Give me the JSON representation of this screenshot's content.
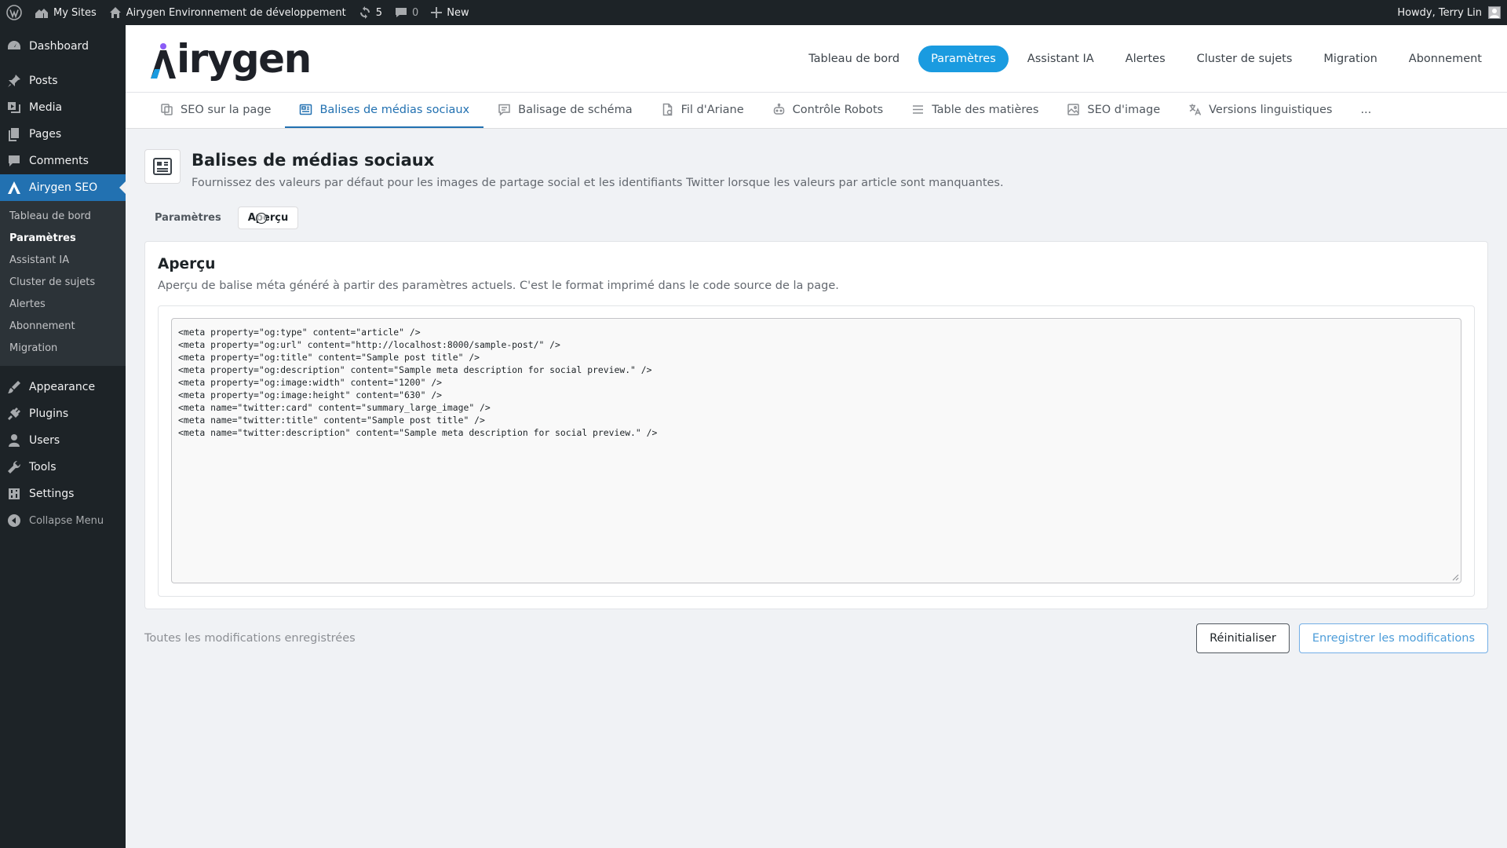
{
  "admin_bar": {
    "wp_logo_icon": "wordpress-icon",
    "my_sites": "My Sites",
    "site_name": "Airygen Environnement de développement",
    "updates_count": "5",
    "comments_count": "0",
    "new_label": "New",
    "howdy": "Howdy, Terry Lin"
  },
  "sidebar": {
    "items_top": [
      {
        "label": "Dashboard",
        "icon": "dashboard-icon"
      },
      {
        "label": "Posts",
        "icon": "pin-icon"
      },
      {
        "label": "Media",
        "icon": "media-icon"
      },
      {
        "label": "Pages",
        "icon": "pages-icon"
      },
      {
        "label": "Comments",
        "icon": "comment-icon"
      }
    ],
    "current": {
      "label": "Airygen SEO",
      "icon": "airygen-icon"
    },
    "submenu": [
      "Tableau de bord",
      "Paramètres",
      "Assistant IA",
      "Cluster de sujets",
      "Alertes",
      "Abonnement",
      "Migration"
    ],
    "submenu_active": "Paramètres",
    "items_bottom": [
      {
        "label": "Appearance",
        "icon": "brush-icon"
      },
      {
        "label": "Plugins",
        "icon": "plug-icon"
      },
      {
        "label": "Users",
        "icon": "user-icon"
      },
      {
        "label": "Tools",
        "icon": "wrench-icon"
      },
      {
        "label": "Settings",
        "icon": "settings-icon"
      }
    ],
    "collapse": "Collapse Menu"
  },
  "header": {
    "logo_text": "irygen",
    "brand_colors": {
      "dark": "#1e2128",
      "purple": "#8a5cf6",
      "blue": "#1a9be0"
    },
    "nav": [
      "Tableau de bord",
      "Paramètres",
      "Assistant IA",
      "Alertes",
      "Cluster de sujets",
      "Migration",
      "Abonnement"
    ],
    "nav_active": "Paramètres"
  },
  "subtabs": [
    {
      "label": "SEO sur la page",
      "icon": "copy-icon"
    },
    {
      "label": "Balises de médias sociaux",
      "icon": "newspaper-icon"
    },
    {
      "label": "Balisage de schéma",
      "icon": "message-icon"
    },
    {
      "label": "Fil d'Ariane",
      "icon": "file-icon"
    },
    {
      "label": "Contrôle Robots",
      "icon": "robot-icon"
    },
    {
      "label": "Table des matières",
      "icon": "list-icon"
    },
    {
      "label": "SEO d'image",
      "icon": "image-icon"
    },
    {
      "label": "Versions linguistiques",
      "icon": "translate-icon"
    }
  ],
  "subtabs_more": "...",
  "page": {
    "title": "Balises de médias sociaux",
    "description": "Fournissez des valeurs par défaut pour les images de partage social et les identifiants Twitter lorsque les valeurs par article sont manquantes.",
    "inner_tabs": [
      "Paramètres",
      "Aperçu"
    ],
    "inner_tab_active": "Aperçu"
  },
  "preview": {
    "title": "Aperçu",
    "description": "Aperçu de balise méta généré à partir des paramètres actuels. C'est le format imprimé dans le code source de la page.",
    "code": "<meta property=\"og:type\" content=\"article\" />\n<meta property=\"og:url\" content=\"http://localhost:8000/sample-post/\" />\n<meta property=\"og:title\" content=\"Sample post title\" />\n<meta property=\"og:description\" content=\"Sample meta description for social preview.\" />\n<meta property=\"og:image:width\" content=\"1200\" />\n<meta property=\"og:image:height\" content=\"630\" />\n<meta name=\"twitter:card\" content=\"summary_large_image\" />\n<meta name=\"twitter:title\" content=\"Sample post title\" />\n<meta name=\"twitter:description\" content=\"Sample meta description for social preview.\" />"
  },
  "footer": {
    "status": "Toutes les modifications enregistrées",
    "reset": "Réinitialiser",
    "save": "Enregistrer les modifications"
  }
}
